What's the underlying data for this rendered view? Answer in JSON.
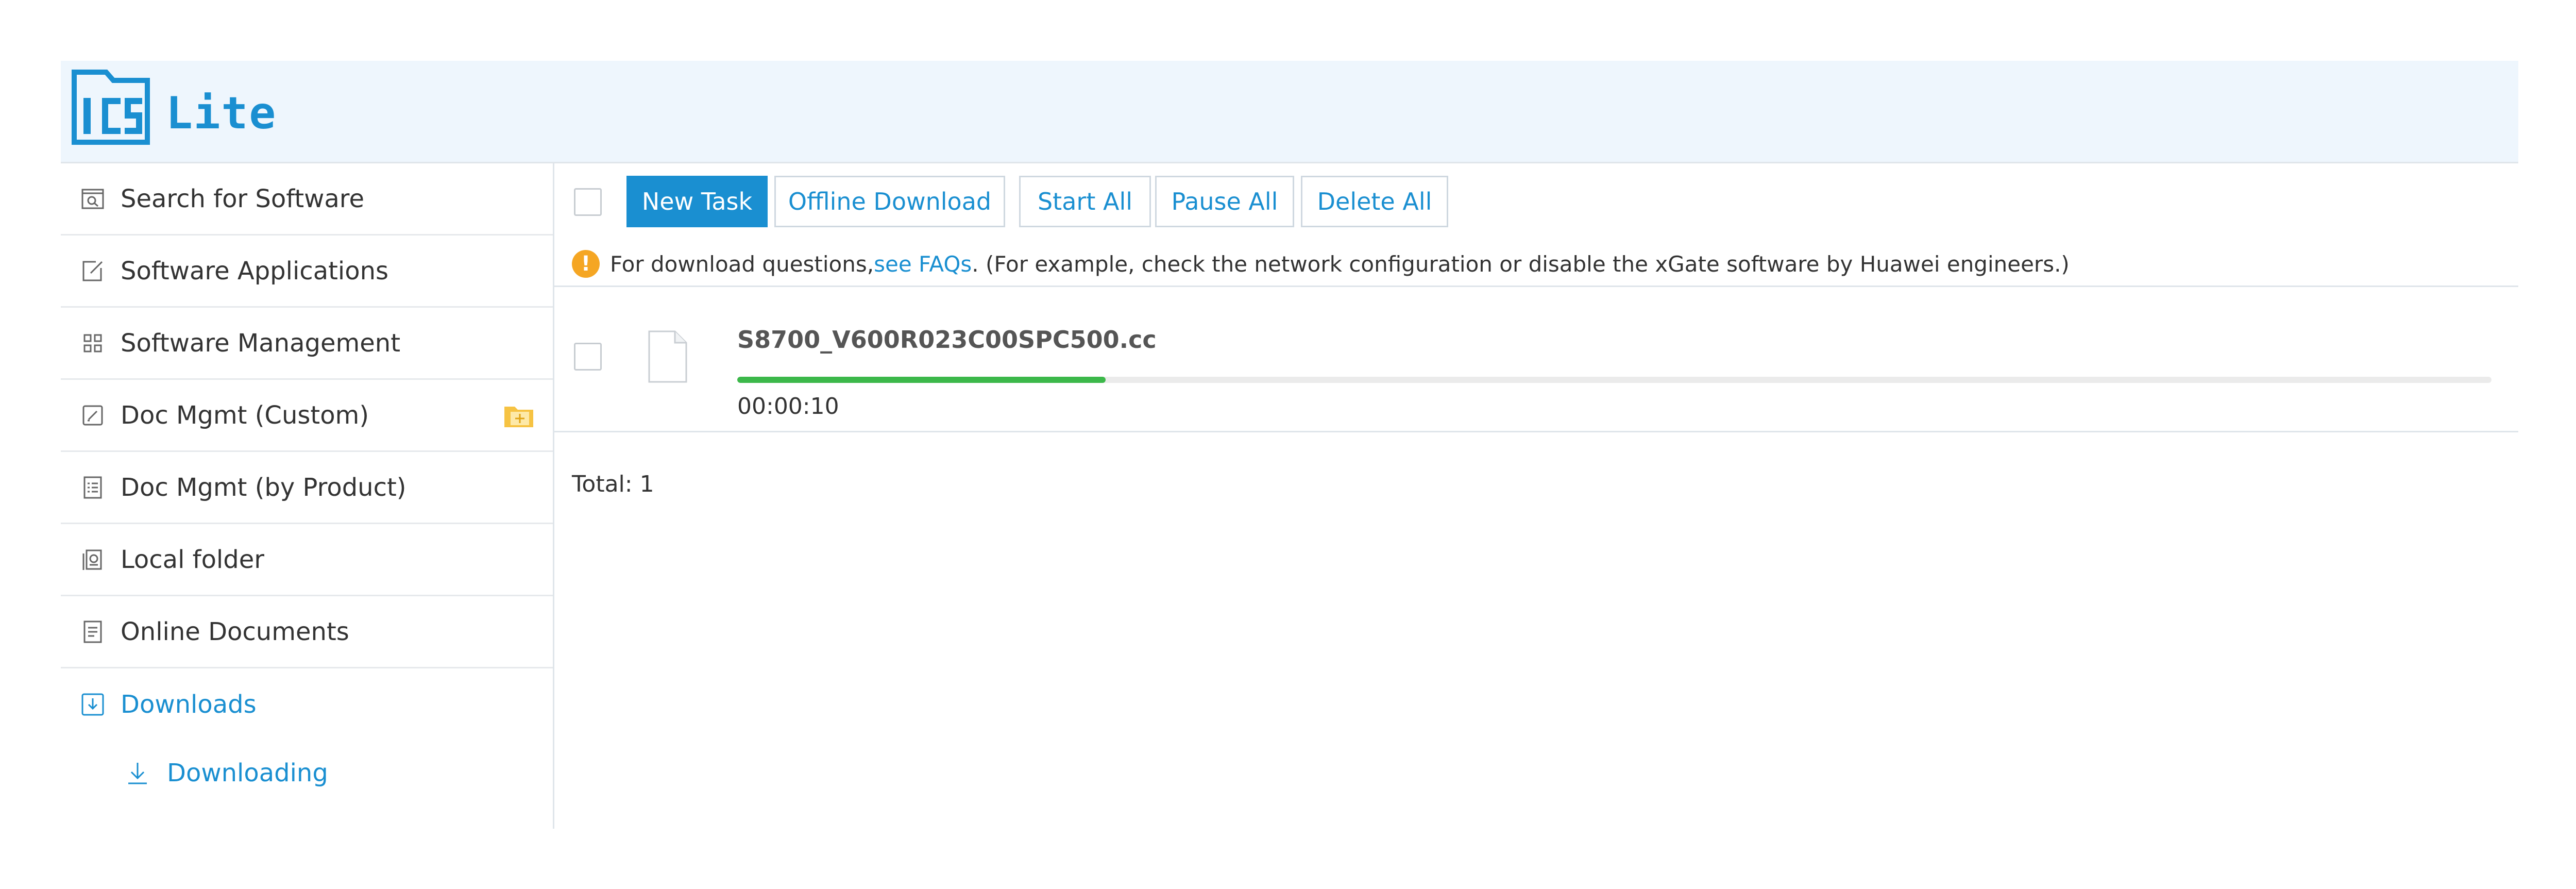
{
  "app": {
    "logo_text": "ICS",
    "title": "Lite"
  },
  "sidebar": {
    "items": [
      {
        "label": "Search for Software",
        "icon": "search-window-icon"
      },
      {
        "label": "Software Applications",
        "icon": "edit-icon"
      },
      {
        "label": "Software Management",
        "icon": "grid-icon"
      },
      {
        "label": "Doc Mgmt (Custom)",
        "icon": "pencil-square-icon",
        "extra_icon": "add-folder-icon"
      },
      {
        "label": "Doc Mgmt (by Product)",
        "icon": "document-list-icon"
      },
      {
        "label": "Local folder",
        "icon": "local-folder-icon"
      },
      {
        "label": "Online Documents",
        "icon": "online-document-icon"
      },
      {
        "label": "Downloads",
        "icon": "download-box-icon",
        "active": true
      }
    ],
    "sub_items": [
      {
        "label": "Downloading",
        "icon": "download-arrow-icon"
      }
    ]
  },
  "toolbar": {
    "new_task": "New Task",
    "offline_download": "Offline Download",
    "start_all": "Start All",
    "pause_all": "Pause All",
    "delete_all": "Delete All"
  },
  "notice": {
    "prefix": "For download questions, ",
    "link": "see FAQs",
    "suffix": ". (For example, check the network configuration or disable the xGate software by Huawei engineers.)"
  },
  "tasks": [
    {
      "file_name": "S8700_V600R023C00SPC500.cc",
      "elapsed": "00:00:10",
      "progress": 0.21
    }
  ],
  "footer": {
    "total_label": "Total: 1"
  },
  "colors": {
    "accent": "#1a8fd1",
    "header_bg": "#eef6fd",
    "progress": "#3cb84a",
    "warning": "#f5a623"
  }
}
